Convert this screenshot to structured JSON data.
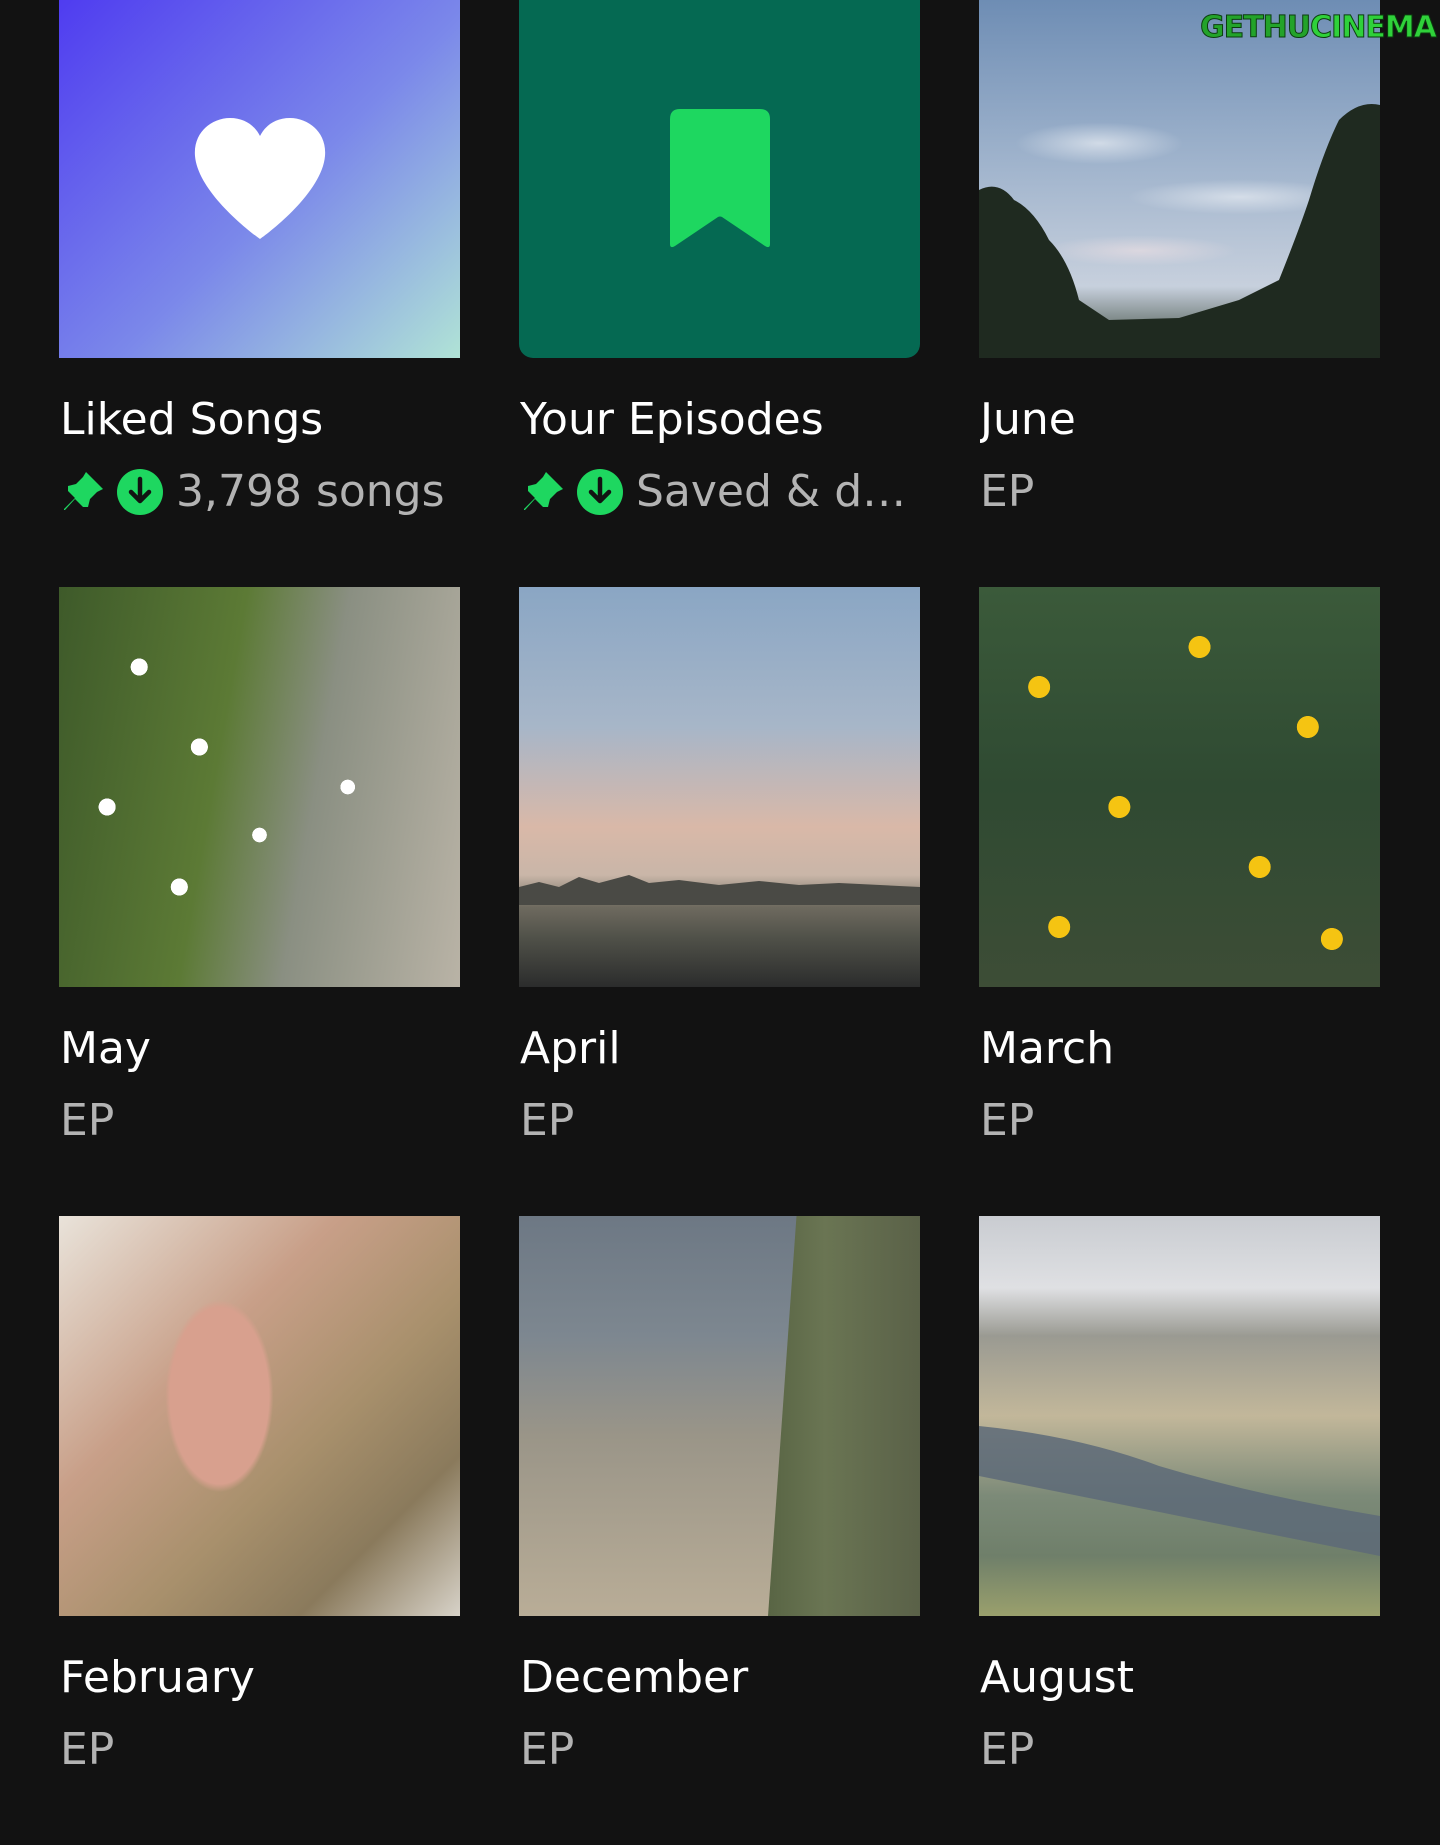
{
  "watermark": {
    "part1": "GETHU",
    "part2": "CINEMA"
  },
  "items": [
    {
      "title": "Liked Songs",
      "subtitle": "3,798 songs",
      "icon": "heart-icon",
      "pinned": true,
      "downloaded": true
    },
    {
      "title": "Your Episodes",
      "subtitle": "Saved & do...",
      "icon": "bookmark-icon",
      "pinned": true,
      "downloaded": true
    },
    {
      "title": "June",
      "subtitle": "EP"
    },
    {
      "title": "May",
      "subtitle": "EP"
    },
    {
      "title": "April",
      "subtitle": "EP"
    },
    {
      "title": "March",
      "subtitle": "EP"
    },
    {
      "title": "February",
      "subtitle": "EP"
    },
    {
      "title": "December",
      "subtitle": "EP"
    },
    {
      "title": "August",
      "subtitle": "EP"
    }
  ],
  "colors": {
    "background": "#121212",
    "accent": "#1ed760",
    "episodes_tile": "#056952",
    "subtitle": "#b3b3b3"
  }
}
